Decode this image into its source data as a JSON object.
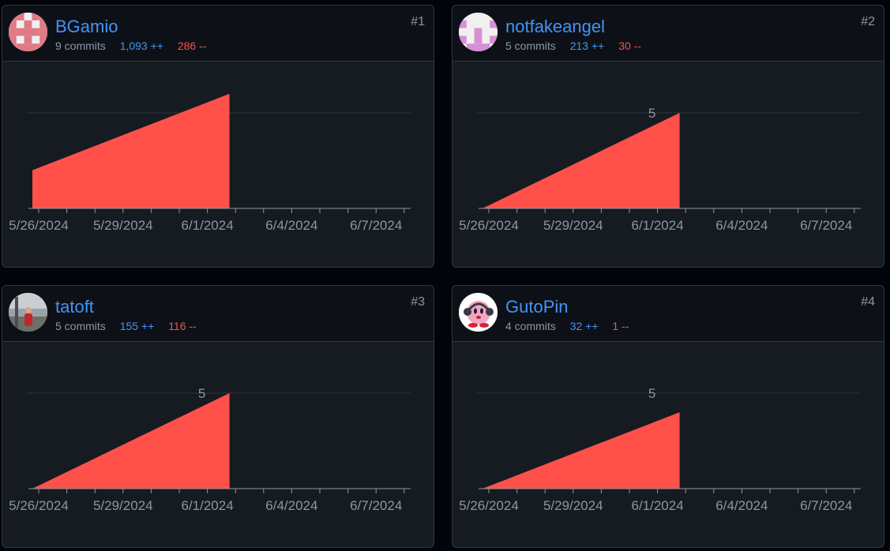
{
  "contributors": [
    {
      "rank": "#1",
      "username": "BGamio",
      "commits": "9 commits",
      "additions": "1,093 ++",
      "deletions": "286 --",
      "avatar_icon": "identicon-red-avatar",
      "chart_data": {
        "type": "area",
        "x": [
          "5/26/2024",
          "6/1/2024"
        ],
        "y": [
          2,
          6
        ],
        "x_ticks": [
          "5/26/2024",
          "5/29/2024",
          "6/1/2024",
          "6/4/2024",
          "6/7/2024"
        ],
        "gridline": 5,
        "peak_label": "",
        "color": "#ff5149"
      }
    },
    {
      "rank": "#2",
      "username": "notfakeangel",
      "commits": "5 commits",
      "additions": "213 ++",
      "deletions": "30 --",
      "avatar_icon": "identicon-pink-avatar",
      "chart_data": {
        "type": "area",
        "x": [
          "5/26/2024",
          "6/1/2024"
        ],
        "y": [
          0,
          5
        ],
        "x_ticks": [
          "5/26/2024",
          "5/29/2024",
          "6/1/2024",
          "6/4/2024",
          "6/7/2024"
        ],
        "gridline": 5,
        "peak_label": "5",
        "color": "#ff5149"
      }
    },
    {
      "rank": "#3",
      "username": "tatoft",
      "commits": "5 commits",
      "additions": "155 ++",
      "deletions": "116 --",
      "avatar_icon": "photo-person-avatar",
      "chart_data": {
        "type": "area",
        "x": [
          "5/26/2024",
          "6/1/2024"
        ],
        "y": [
          0,
          5
        ],
        "x_ticks": [
          "5/26/2024",
          "5/29/2024",
          "6/1/2024",
          "6/4/2024",
          "6/7/2024"
        ],
        "gridline": 5,
        "peak_label": "5",
        "color": "#ff5149"
      }
    },
    {
      "rank": "#4",
      "username": "GutoPin",
      "commits": "4 commits",
      "additions": "32 ++",
      "deletions": "1 --",
      "avatar_icon": "kirby-character-avatar",
      "chart_data": {
        "type": "area",
        "x": [
          "5/26/2024",
          "6/1/2024"
        ],
        "y": [
          0,
          4
        ],
        "x_ticks": [
          "5/26/2024",
          "5/29/2024",
          "6/1/2024",
          "6/4/2024",
          "6/7/2024"
        ],
        "gridline": 5,
        "peak_label": "5",
        "color": "#ff5149"
      }
    }
  ]
}
